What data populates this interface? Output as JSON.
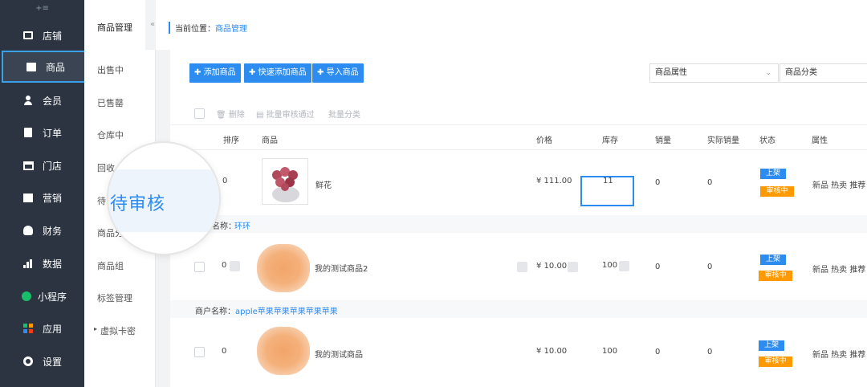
{
  "sidebar": {
    "collapse_label": "+≡",
    "items": [
      {
        "label": "店铺",
        "icon": "store-icon"
      },
      {
        "label": "商品",
        "icon": "goods-icon"
      },
      {
        "label": "会员",
        "icon": "member-icon"
      },
      {
        "label": "订单",
        "icon": "order-icon"
      },
      {
        "label": "门店",
        "icon": "shop-icon"
      },
      {
        "label": "营销",
        "icon": "gift-icon"
      },
      {
        "label": "财务",
        "icon": "money-bag-icon"
      },
      {
        "label": "数据",
        "icon": "bar-chart-icon"
      },
      {
        "label": "小程序",
        "icon": "mini-program-icon"
      },
      {
        "label": "应用",
        "icon": "apps-icon"
      },
      {
        "label": "设置",
        "icon": "gear-icon"
      }
    ],
    "active_index": 1
  },
  "subnav": {
    "title": "商品管理",
    "collapse_arrow": "«",
    "items": [
      "出售中",
      "已售罄",
      "仓库中",
      "回收",
      "待",
      "商品分",
      "商品组",
      "标签管理",
      "虚拟卡密"
    ]
  },
  "magnifier": {
    "label": "待审核"
  },
  "breadcrumb": {
    "prefix": "当前位置：",
    "current": "商品管理"
  },
  "toolbar": {
    "add": "添加商品",
    "quick_add": "快速添加商品",
    "import": "导入商品",
    "attr_select": "商品属性",
    "category_select": "商品分类"
  },
  "bulk": {
    "delete": "删除",
    "approve": "批量审核通过",
    "categorize": "批量分类"
  },
  "table": {
    "headers": [
      "排序",
      "商品",
      "价格",
      "库存",
      "销量",
      "实际销量",
      "状态",
      "属性"
    ],
    "rows": [
      {
        "sort": "0",
        "name": "鲜花",
        "price": "¥ 111.00",
        "stock": "11",
        "sales": "0",
        "actual": "0",
        "status_on": "上架",
        "status_review": "审核中",
        "attrs": "新品 热卖 推荐"
      },
      {
        "sort": "0",
        "name": "我的测试商品2",
        "price": "¥ 10.00",
        "stock": "100",
        "sales": "0",
        "actual": "0",
        "status_on": "上架",
        "status_review": "审核中",
        "attrs": "新品 热卖 推荐"
      },
      {
        "sort": "0",
        "name": "我的测试商品",
        "price": "¥ 10.00",
        "stock": "100",
        "sales": "0",
        "actual": "0",
        "status_on": "上架",
        "status_review": "审核中",
        "attrs": "新品 热卖 推荐"
      }
    ],
    "merchants": [
      {
        "prefix": "名称：",
        "name": "环环"
      },
      {
        "prefix": "商户名称：",
        "name": "apple苹果苹果苹果苹果苹果"
      }
    ]
  },
  "colors": {
    "accent": "#2d8cf0",
    "warning": "#ff9900",
    "sidebar_bg": "#2b3440"
  }
}
